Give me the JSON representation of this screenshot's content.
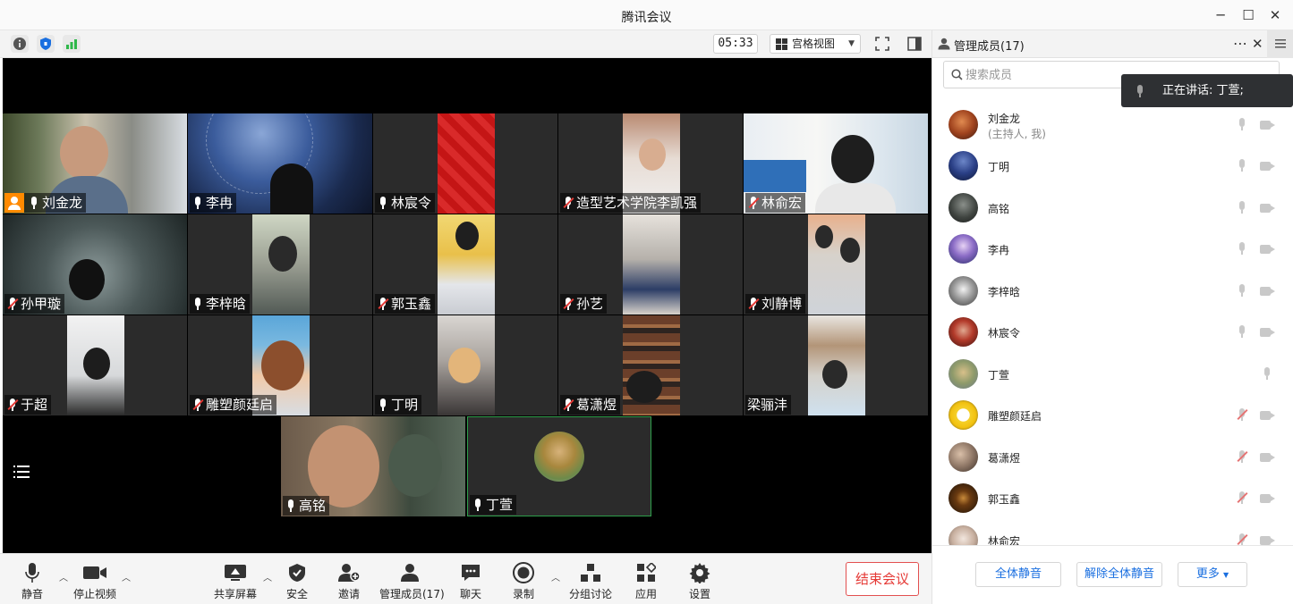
{
  "window": {
    "title": "腾讯会议"
  },
  "topbar": {
    "timer": "05:33",
    "view_label": "宫格视图"
  },
  "tiles": [
    {
      "name": "刘金龙",
      "muted": false,
      "host": true
    },
    {
      "name": "李冉",
      "muted": false
    },
    {
      "name": "林宸令",
      "muted": false
    },
    {
      "name": "造型艺术学院李凯强",
      "muted": true
    },
    {
      "name": "林俞宏",
      "muted": true
    },
    {
      "name": "孙甲璇",
      "muted": true
    },
    {
      "name": "李梓晗",
      "muted": false
    },
    {
      "name": "郭玉鑫",
      "muted": true
    },
    {
      "name": "孙艺",
      "muted": true
    },
    {
      "name": "刘静博",
      "muted": true
    },
    {
      "name": "于超",
      "muted": true
    },
    {
      "name": "雕塑颜廷启",
      "muted": true
    },
    {
      "name": "丁明",
      "muted": false
    },
    {
      "name": "葛潇煜",
      "muted": true
    },
    {
      "name": "梁骊沣",
      "muted": null
    },
    {
      "name": "高铭",
      "muted": false
    },
    {
      "name": "丁萱",
      "muted": false
    }
  ],
  "toolbar": {
    "mute": "静音",
    "stop_video": "停止视频",
    "share": "共享屏幕",
    "security": "安全",
    "invite": "邀请",
    "members": "管理成员(17)",
    "chat": "聊天",
    "record": "录制",
    "breakout": "分组讨论",
    "apps": "应用",
    "settings": "设置",
    "end": "结束会议"
  },
  "panel": {
    "title": "管理成员(17)",
    "search_placeholder": "搜索成员",
    "speaking": "正在讲话: 丁萱;",
    "members": [
      {
        "name": "刘金龙",
        "sub": "(主持人, 我)",
        "mic": "on",
        "cam": true
      },
      {
        "name": "丁明",
        "mic": "on",
        "cam": true
      },
      {
        "name": "高铭",
        "mic": "on",
        "cam": true
      },
      {
        "name": "李冉",
        "mic": "on",
        "cam": true
      },
      {
        "name": "李梓晗",
        "mic": "on",
        "cam": true
      },
      {
        "name": "林宸令",
        "mic": "on",
        "cam": true
      },
      {
        "name": "丁萱",
        "mic": "on",
        "cam": false
      },
      {
        "name": "雕塑颜廷启",
        "mic": "off",
        "cam": true
      },
      {
        "name": "葛潇煜",
        "mic": "off",
        "cam": true
      },
      {
        "name": "郭玉鑫",
        "mic": "off",
        "cam": true
      },
      {
        "name": "林俞宏",
        "mic": "off",
        "cam": true
      }
    ],
    "mute_all": "全体静音",
    "unmute_all": "解除全体静音",
    "more": "更多"
  },
  "colors": {
    "accent": "#1a6fe0",
    "end": "#e53935",
    "host_badge": "#ff8a00",
    "speaking_border": "#2e9e4a"
  },
  "icons": [
    "info-icon",
    "shield-icon",
    "signal-icon",
    "grid-icon",
    "fullscreen-icon",
    "sidebar-toggle-icon",
    "more-icon",
    "close-icon",
    "search-icon",
    "list-icon"
  ]
}
